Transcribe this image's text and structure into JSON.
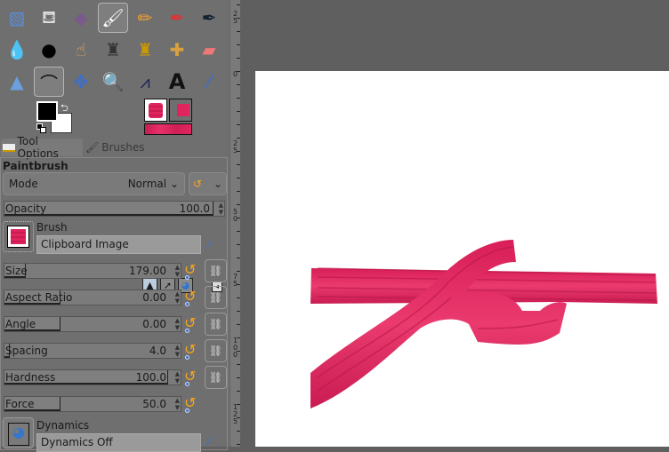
{
  "toolbox": {
    "tools": [
      [
        "foreground-select-icon",
        "bucket-fill-icon",
        "gradient-icon",
        "paintbrush-icon",
        "pencil-icon",
        "airbrush-icon",
        "ink-icon"
      ],
      [
        "blur-icon",
        "smudge-dodge-icon",
        "smudge-icon",
        "clone-icon",
        "perspective-clone-icon",
        "heal-icon",
        "eraser-icon"
      ],
      [
        "levels-icon",
        "curves-icon",
        "move-icon",
        "zoom-icon",
        "measure-icon",
        "text-icon",
        "color-picker-icon"
      ]
    ],
    "selected_tools": [
      "paintbrush-icon",
      "curves-icon"
    ],
    "fg_color": "#000000",
    "bg_color": "#ffffff",
    "brush_color": "#e0245e"
  },
  "tabs": {
    "tool_options": "Tool Options",
    "brushes": "Brushes"
  },
  "options": {
    "tool_name": "Paintbrush",
    "mode_label": "Mode",
    "mode_value": "Normal",
    "opacity": {
      "label": "Opacity",
      "value": "100.0",
      "fraction": 1.0
    },
    "brush_label": "Brush",
    "brush_value": "Clipboard Image",
    "sliders": [
      {
        "label": "Size",
        "value": "179.00",
        "fraction": 0.19,
        "chain": true
      },
      {
        "label": "Aspect Ratio",
        "value": "0.00",
        "fraction": 0.5,
        "chain": true
      },
      {
        "label": "Angle",
        "value": "0.00",
        "fraction": 0.5,
        "chain": true
      },
      {
        "label": "Spacing",
        "value": "4.0",
        "fraction": 0.02,
        "chain": true
      },
      {
        "label": "Hardness",
        "value": "100.0",
        "fraction": 1.0,
        "chain": true
      },
      {
        "label": "Force",
        "value": "50.0",
        "fraction": 0.5,
        "chain": false
      }
    ],
    "dynamics_label": "Dynamics",
    "dynamics_value": "Dynamics Off"
  },
  "ruler": {
    "labels": [
      "25",
      "0",
      "25",
      "50",
      "75",
      "100",
      "125"
    ]
  }
}
